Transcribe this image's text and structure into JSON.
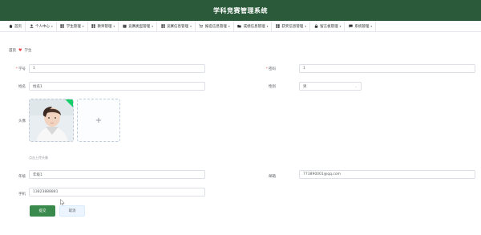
{
  "header": {
    "title": "学科竞赛管理系统"
  },
  "nav": [
    {
      "label": "首页",
      "icon": "home-icon",
      "has_caret": false
    },
    {
      "label": "个人中心",
      "icon": "user-icon",
      "has_caret": true
    },
    {
      "label": "学生管理",
      "icon": "grid-icon",
      "has_caret": true
    },
    {
      "label": "教师管理",
      "icon": "grid-icon",
      "has_caret": true
    },
    {
      "label": "竞赛类型管理",
      "icon": "box-icon",
      "has_caret": true
    },
    {
      "label": "竞赛信息管理",
      "icon": "grid-icon",
      "has_caret": true
    },
    {
      "label": "报名信息管理",
      "icon": "cart-icon",
      "has_caret": true
    },
    {
      "label": "成绩信息管理",
      "icon": "folder-icon",
      "has_caret": true
    },
    {
      "label": "获奖信息管理",
      "icon": "grid-icon",
      "has_caret": true
    },
    {
      "label": "留言板管理",
      "icon": "lock-icon",
      "has_caret": true
    },
    {
      "label": "系统管理",
      "icon": "chat-icon",
      "has_caret": true
    }
  ],
  "breadcrumb": {
    "home": "首页",
    "current": "学生"
  },
  "form": {
    "student_id_label": "学号",
    "student_id_value": "1",
    "password_label": "密码",
    "password_value": "1",
    "name_label": "姓名",
    "name_value": "姓名1",
    "gender_label": "性别",
    "gender_value": "男",
    "avatar_label": "头像",
    "avatar_hint": "点击上传头像",
    "major_label": "年级",
    "major_value": "年级1",
    "email_label": "邮箱",
    "email_value": "773890001@qq.com",
    "phone_label": "手机",
    "phone_value": "13823888881",
    "submit_label": "提交",
    "cancel_label": "取消"
  },
  "colors": {
    "header_bg": "#2a5a3a",
    "primary": "#3a8a4e",
    "required": "#f56c6c"
  }
}
